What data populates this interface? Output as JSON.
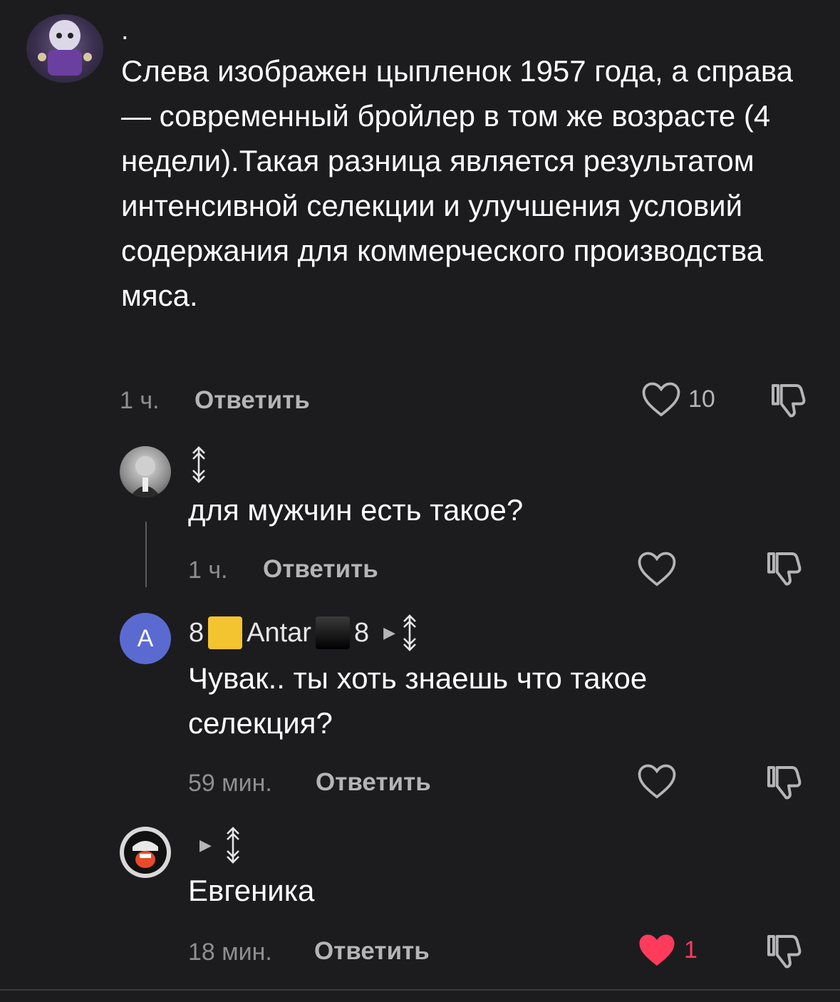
{
  "comments": [
    {
      "username": ".",
      "text": "Слева изображен цыпленок 1957 года, а справа — современный бройлер в том же возрасте (4 недели).Такая разница является результатом интенсивной селекции и улучшения условий содержания для коммерческого производства мяса.",
      "time": "1 ч.",
      "reply_label": "Ответить",
      "likes": "10",
      "liked": false
    },
    {
      "username": "",
      "text": "для мужчин есть такое?",
      "time": "1 ч.",
      "reply_label": "Ответить",
      "likes": "",
      "liked": false
    },
    {
      "username_prefix": "8",
      "username_mid": "Antar",
      "username_suffix": "8",
      "avatar_letter": "A",
      "text": "Чувак.. ты хоть знаешь что такое селекция?",
      "time": "59 мин.",
      "reply_label": "Ответить",
      "likes": "",
      "liked": false
    },
    {
      "username": "",
      "text": "Евгеника",
      "time": "18 мин.",
      "reply_label": "Ответить",
      "likes": "1",
      "liked": true
    }
  ],
  "colors": {
    "background": "#1c1c1e",
    "like_active": "#ff3b5c",
    "avatar_letter_bg": "#5b6ad0"
  },
  "icons": [
    "heart-icon",
    "dislike-icon",
    "rune-badge-icon",
    "reply-arrow-icon"
  ]
}
